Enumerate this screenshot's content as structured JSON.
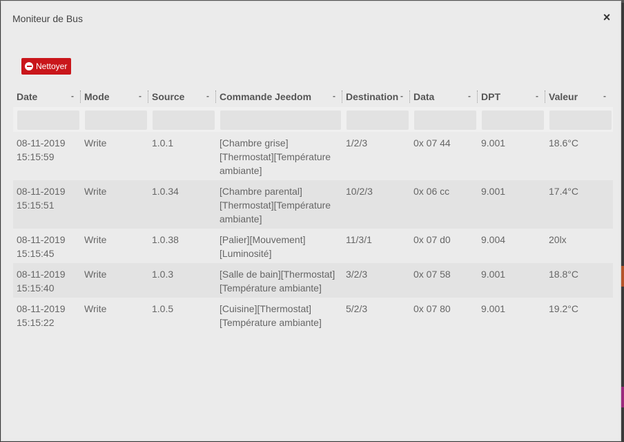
{
  "modal": {
    "title": "Moniteur de Bus",
    "close_label": "×",
    "clear_label": "Nettoyer"
  },
  "table": {
    "columns": [
      {
        "label": "Date",
        "sort": "-"
      },
      {
        "label": "Mode",
        "sort": "-"
      },
      {
        "label": "Source",
        "sort": "-"
      },
      {
        "label": "Commande Jeedom",
        "sort": "-"
      },
      {
        "label": "Destination",
        "sort": "-"
      },
      {
        "label": "Data",
        "sort": "-"
      },
      {
        "label": "DPT",
        "sort": "-"
      },
      {
        "label": "Valeur",
        "sort": "-"
      }
    ],
    "rows": [
      {
        "date": "08-11-2019\n15:15:59",
        "mode": "Write",
        "source": "1.0.1",
        "commande": "[Chambre grise]\n[Thermostat][Température\nambiante]",
        "destination": "1/2/3",
        "data": "0x 07 44",
        "dpt": "9.001",
        "valeur": "18.6°C"
      },
      {
        "date": "08-11-2019\n15:15:51",
        "mode": "Write",
        "source": "1.0.34",
        "commande": "[Chambre parental]\n[Thermostat][Température\nambiante]",
        "destination": "10/2/3",
        "data": "0x 06 cc",
        "dpt": "9.001",
        "valeur": "17.4°C"
      },
      {
        "date": "08-11-2019\n15:15:45",
        "mode": "Write",
        "source": "1.0.38",
        "commande": "[Palier][Mouvement]\n[Luminosité]",
        "destination": "11/3/1",
        "data": "0x 07 d0",
        "dpt": "9.004",
        "valeur": "20lx"
      },
      {
        "date": "08-11-2019\n15:15:40",
        "mode": "Write",
        "source": "1.0.3",
        "commande": "[Salle de bain][Thermostat]\n[Température ambiante]",
        "destination": "3/2/3",
        "data": "0x 07 58",
        "dpt": "9.001",
        "valeur": "18.8°C"
      },
      {
        "date": "08-11-2019\n15:15:22",
        "mode": "Write",
        "source": "1.0.5",
        "commande": "[Cuisine][Thermostat]\n[Température ambiante]",
        "destination": "5/2/3",
        "data": "0x 07 80",
        "dpt": "9.001",
        "valeur": "19.2°C"
      }
    ]
  },
  "colors": {
    "clear_button": "#c9161b",
    "modal_bg": "#ebebeb",
    "row_alt": "#e3e3e3"
  }
}
